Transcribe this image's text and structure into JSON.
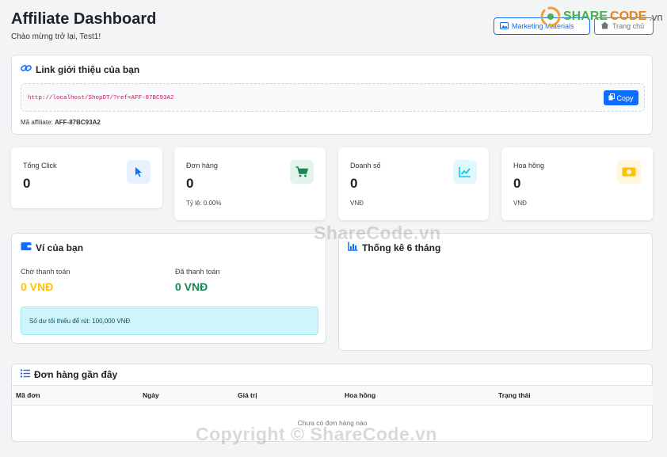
{
  "header": {
    "title": "Affiliate Dashboard",
    "welcome": "Chào mừng trở lại, Test1!",
    "marketing_button": "Marketing Materials",
    "home_button": "Trang chủ"
  },
  "referral": {
    "heading": "Link giới thiệu của bạn",
    "url": "http://localhost/ShopDT/?ref=AFF-87BC93A2",
    "copy_label": "Copy",
    "code_label": "Mã affiliate:",
    "code_value": "AFF-87BC93A2"
  },
  "stats": [
    {
      "label": "Tổng Click",
      "value": "0",
      "sub": "",
      "icon": "cursor-icon",
      "color": "#0d6efd",
      "bg": "#e7f0ff"
    },
    {
      "label": "Đơn hàng",
      "value": "0",
      "sub": "Tỷ lệ: 0.00%",
      "icon": "cart-icon",
      "color": "#198754",
      "bg": "#e3f4ea"
    },
    {
      "label": "Doanh số",
      "value": "0",
      "sub": "VNĐ",
      "icon": "chart-line-icon",
      "color": "#0dcaf0",
      "bg": "#e1f8fd"
    },
    {
      "label": "Hoa hồng",
      "value": "0",
      "sub": "VNĐ",
      "icon": "money-icon",
      "color": "#ffc107",
      "bg": "#fff6dc"
    }
  ],
  "wallet": {
    "heading": "Ví của bạn",
    "pending_label": "Chờ thanh toán",
    "pending_value": "0 VNĐ",
    "paid_label": "Đã thanh toán",
    "paid_value": "0 VNĐ",
    "min_notice": "Số dư tối thiểu để rút: 100,000 VNĐ",
    "pending_color": "#ffc107",
    "paid_color": "#198754"
  },
  "stats6": {
    "heading": "Thống kê 6 tháng"
  },
  "orders": {
    "heading": "Đơn hàng gần đây",
    "columns": [
      "Mã đơn",
      "Ngày",
      "Giá trị",
      "Hoa hồng",
      "Trạng thái"
    ],
    "empty_text": "Chưa có đơn hàng nào"
  },
  "watermark": {
    "logo_a": "SHARE",
    "logo_b": "CODE",
    "logo_c": ".vn",
    "center": "ShareCode.vn",
    "bottom": "Copyright © ShareCode.vn"
  }
}
